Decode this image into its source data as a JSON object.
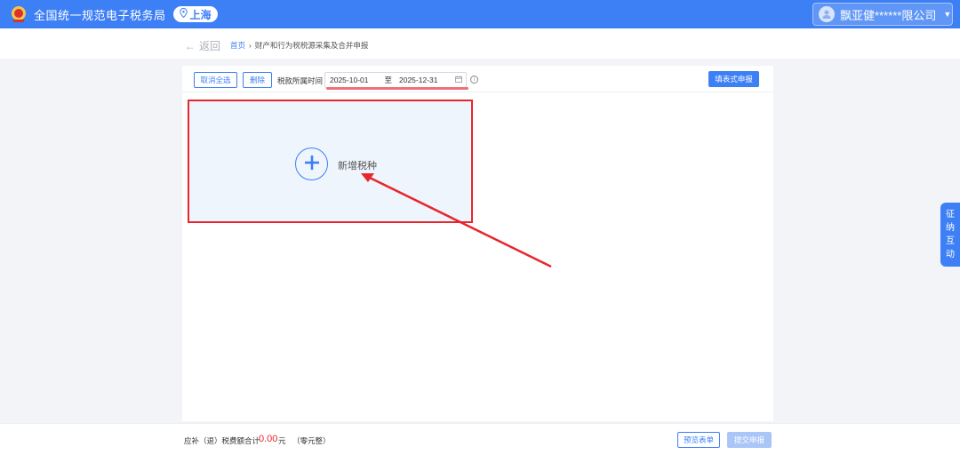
{
  "header": {
    "site_title": "全国统一规范电子税务局",
    "region": "上海",
    "user_name": "飘亚健******限公司"
  },
  "breadcrumb": {
    "back_label": "返回",
    "home": "首页",
    "current": "财产和行为税税源采集及合并申报"
  },
  "toolbar": {
    "deselect_all": "取消全选",
    "delete": "删除",
    "period_label": "税款所属时间",
    "date_start": "2025-10-01",
    "date_sep": "至",
    "date_end": "2025-12-31",
    "form_declare": "填表式申报"
  },
  "add_card": {
    "label": "新增税种"
  },
  "side_tab": {
    "chars": [
      "征",
      "纳",
      "互",
      "动"
    ]
  },
  "footer": {
    "total_label": "应补（退）税费额合计",
    "total_amount": "0.00",
    "total_unit": "元",
    "total_note": "（零元整）",
    "preview_label": "预览表单",
    "submit_label": "提交申报"
  },
  "colors": {
    "brand": "#3d7ff5",
    "annotation_red": "#e8262e"
  },
  "icons": [
    "emblem-icon",
    "location-pin-icon",
    "avatar-icon",
    "caret-down-icon",
    "back-arrow-icon",
    "calendar-icon",
    "info-icon",
    "plus-icon"
  ]
}
